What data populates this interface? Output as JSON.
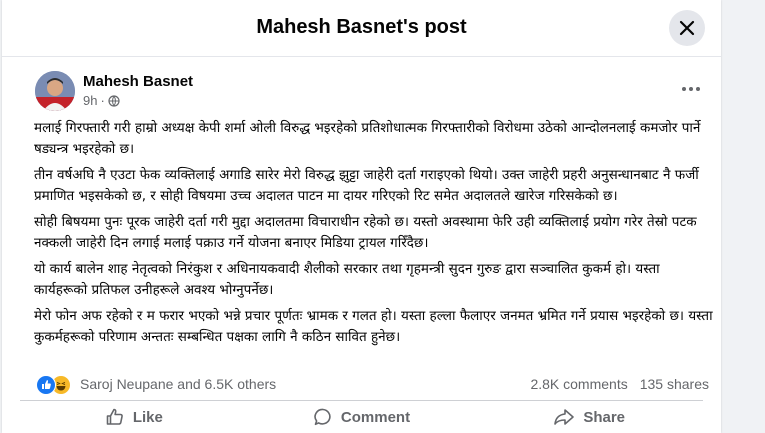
{
  "header": {
    "title": "Mahesh Basnet's post",
    "close_icon": "close-icon"
  },
  "post": {
    "author": "Mahesh Basnet",
    "time": "9h",
    "separator": "·",
    "audience_icon": "globe-icon",
    "more_icon": "more-horizontal-icon",
    "paragraphs": [
      "मलाई गिरफ्तारी गरी हाम्रो अध्यक्ष केपी शर्मा ओली विरुद्ध भइरहेको प्रतिशोधात्मक गिरफ्तारीको विरोधमा उठेको आन्दोलनलाई कमजोर पार्ने षड्यन्त्र भइरहेको छ।",
      "तीन वर्षअघि नै एउटा फेक व्यक्तिलाई अगाडि सारेर मेरो विरुद्ध झुट्टा जाहेरी दर्ता गराइएको थियो। उक्त जाहेरी प्रहरी अनुसन्धानबाट नै फर्जी प्रमाणित भइसकेको छ, र सोही विषयमा उच्च अदालत पाटन मा दायर गरिएको रिट समेत अदालतले खारेज गरिसकेको छ।",
      " सोही बिषयमा पुनः पूरक जाहेरी दर्ता गरी मुद्दा अदालतमा विचाराधीन रहेको  छ। यस्तो अवस्थामा फेरि उही व्यक्तिलाई प्रयोग गरेर तेस्रो पटक नक्कली जाहेरी दिन लगाई मलाई पक्राउ गर्ने योजना बनाएर मिडिया ट्रायल गरिँदैछ।",
      "यो कार्य बालेन शाह नेतृत्वको निरंकुश र अधिनायकवादी शैलीको सरकार तथा गृहमन्त्री सुदन गुरुङ द्वारा सञ्चालित कुकर्म हो। यस्ता कार्यहरूको प्रतिफल उनीहरूले अवश्य भोग्नुपर्नेछ।",
      "मेरो फोन अफ रहेको र म फरार भएको भन्ने प्रचार पूर्णतः भ्रामक र गलत हो। यस्ता हल्ला फैलाएर जनमत भ्रमित गर्ने प्रयास भइरहेको छ। यस्ता कुकर्महरूको परिणाम अन्ततः सम्बन्धित पक्षका लागि नै कठिन सावित हुनेछ।"
    ]
  },
  "reactions": {
    "icons": [
      "like-reaction-icon",
      "haha-reaction-icon"
    ],
    "names": "Saroj Neupane and 6.5K others",
    "comments": "2.8K comments",
    "shares": "135 shares"
  },
  "actions": {
    "like": "Like",
    "comment": "Comment",
    "share": "Share"
  },
  "colors": {
    "background": "#f0f2f5",
    "like_blue": "#1877f2",
    "haha_yellow": "#f7b928",
    "secondary_text": "#65676b"
  }
}
